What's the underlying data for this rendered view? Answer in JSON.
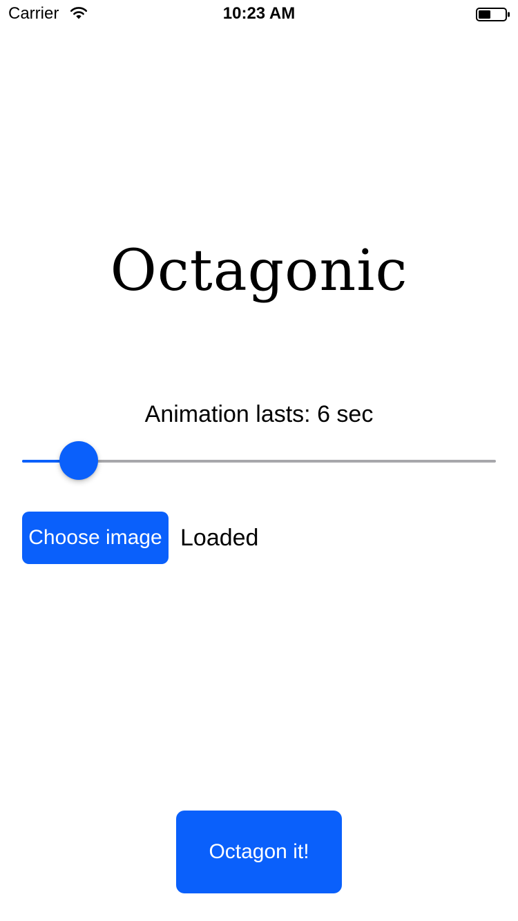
{
  "status_bar": {
    "carrier": "Carrier",
    "time": "10:23 AM",
    "wifi_icon": "wifi-icon",
    "battery_icon": "battery-icon"
  },
  "app": {
    "title": "Octagonic"
  },
  "animation": {
    "label": "Animation lasts: 6 sec",
    "slider_value_fraction": 0.12
  },
  "image": {
    "choose_label": "Choose image",
    "status": "Loaded"
  },
  "action": {
    "label": "Octagon it!"
  },
  "colors": {
    "accent": "#0a60fb",
    "track": "#a7a7ab",
    "text": "#000000",
    "background": "#ffffff"
  }
}
